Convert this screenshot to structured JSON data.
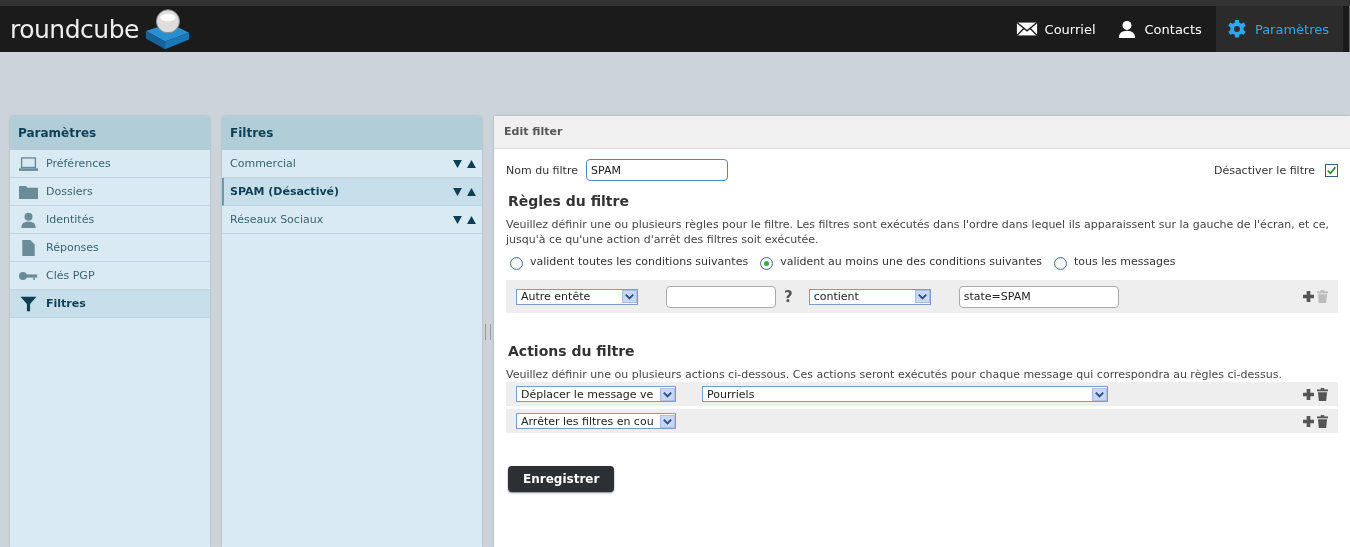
{
  "header": {
    "logo": "roundcube",
    "nav": [
      {
        "label": "Courriel",
        "selected": false
      },
      {
        "label": "Contacts",
        "selected": false
      },
      {
        "label": "Paramètres",
        "selected": true
      }
    ]
  },
  "settings_sidebar": {
    "title": "Paramètres",
    "items": [
      {
        "label": "Préférences",
        "selected": false
      },
      {
        "label": "Dossiers",
        "selected": false
      },
      {
        "label": "Identités",
        "selected": false
      },
      {
        "label": "Réponses",
        "selected": false
      },
      {
        "label": "Clés PGP",
        "selected": false
      },
      {
        "label": "Filtres",
        "selected": true
      }
    ]
  },
  "filters_list": {
    "title": "Filtres",
    "items": [
      {
        "label": "Commercial",
        "selected": false
      },
      {
        "label": "SPAM (Désactivé)",
        "selected": true
      },
      {
        "label": "Réseaux Sociaux",
        "selected": false
      }
    ]
  },
  "edit_filter": {
    "title": "Edit filter",
    "name_label": "Nom du filtre",
    "name_value": "SPAM",
    "disable_label": "Désactiver le filtre",
    "disable_checked": true,
    "rules_heading": "Règles du filtre",
    "rules_description": "Veuillez définir une ou plusieurs règles pour le filtre. Les filtres sont exécutés dans l'ordre dans lequel ils apparaissent sur la gauche de l'écran, et ce, jusqu'à ce qu'une action d'arrêt des filtres soit exécutée.",
    "match_options": [
      {
        "label": "valident toutes les conditions suivantes",
        "selected": false
      },
      {
        "label": "valident au moins une des conditions suivantes",
        "selected": true
      },
      {
        "label": "tous les messages",
        "selected": false
      }
    ],
    "rules": [
      {
        "header": "Autre entête",
        "help": "?",
        "operator": "contient",
        "value": "state=SPAM",
        "delete_disabled": true
      }
    ],
    "actions_heading": "Actions du filtre",
    "actions_description": "Veuillez définir une ou plusieurs actions ci-dessous. Ces actions seront exécutés pour chaque message qui correspondra au règles ci-dessus.",
    "actions": [
      {
        "action": "Déplacer le message ve",
        "target": "Pourriels",
        "delete_disabled": false
      },
      {
        "action": "Arrêter les filtres en cou",
        "delete_disabled": false
      }
    ],
    "save_button": "Enregistrer"
  }
}
